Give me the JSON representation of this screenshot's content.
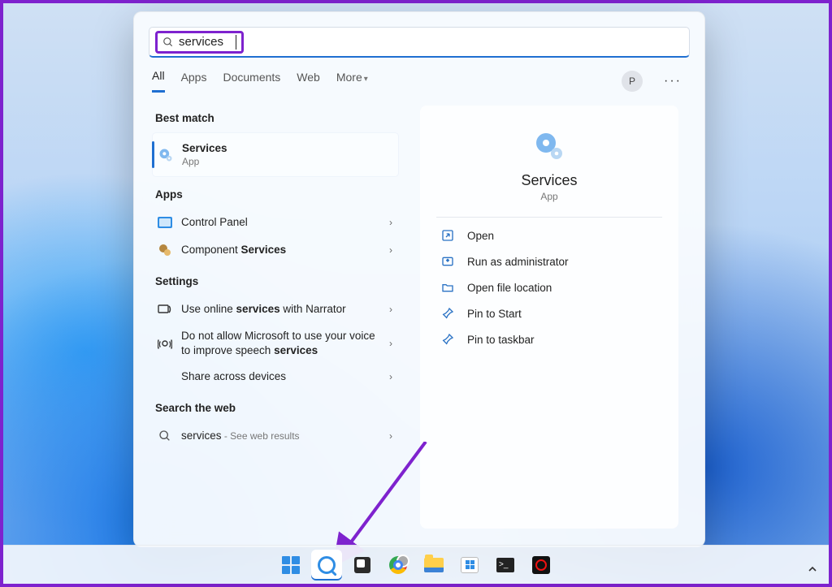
{
  "search": {
    "query": "services"
  },
  "tabs": {
    "all": "All",
    "apps": "Apps",
    "documents": "Documents",
    "web": "Web",
    "more": "More"
  },
  "profile_initial": "P",
  "sections": {
    "best_match": "Best match",
    "apps": "Apps",
    "settings": "Settings",
    "search_web": "Search the web"
  },
  "best_match": {
    "title": "Services",
    "subtitle": "App"
  },
  "apps_list": {
    "control_panel": "Control Panel",
    "component_services_pre": "Component ",
    "component_services_bold": "Services"
  },
  "settings_list": {
    "narrator_pre": "Use online ",
    "narrator_bold": "services",
    "narrator_post": " with Narrator",
    "speech_pre": "Do not allow Microsoft to use your voice to improve speech ",
    "speech_bold": "services",
    "share": "Share across devices"
  },
  "web_row": {
    "term": "services",
    "suffix": " - See web results"
  },
  "details": {
    "title": "Services",
    "subtitle": "App",
    "actions": {
      "open": "Open",
      "run_admin": "Run as administrator",
      "open_loc": "Open file location",
      "pin_start": "Pin to Start",
      "pin_taskbar": "Pin to taskbar"
    }
  }
}
